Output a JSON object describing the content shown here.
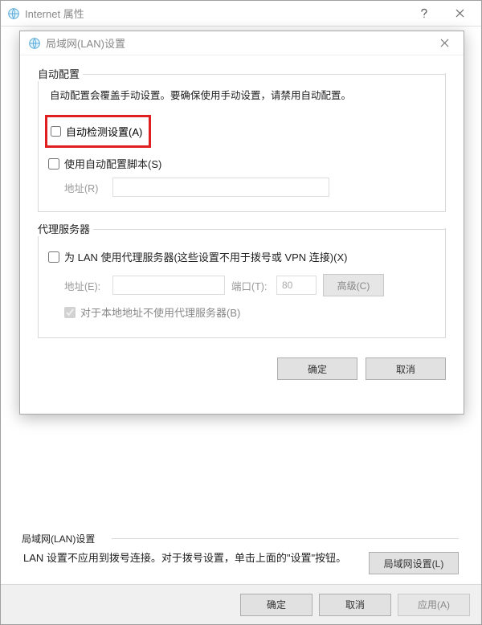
{
  "parent": {
    "title": "Internet 属性",
    "lan_section": {
      "header_truncated": "局域网(LAN)设置",
      "desc": "LAN 设置不应用到拨号连接。对于拨号设置，单击上面的\"设置\"按钮。",
      "button": "局域网设置(L)"
    },
    "footer": {
      "ok": "确定",
      "cancel": "取消",
      "apply": "应用(A)"
    }
  },
  "child": {
    "title": "局域网(LAN)设置",
    "auto": {
      "legend": "自动配置",
      "desc": "自动配置会覆盖手动设置。要确保使用手动设置，请禁用自动配置。",
      "auto_detect": "自动检测设置(A)",
      "use_script": "使用自动配置脚本(S)",
      "address_label": "地址(R)",
      "address_value": ""
    },
    "proxy": {
      "legend": "代理服务器",
      "use_proxy": "为 LAN 使用代理服务器(这些设置不用于拨号或 VPN 连接)(X)",
      "address_label": "地址(E):",
      "address_value": "",
      "port_label": "端口(T):",
      "port_value": "80",
      "advanced": "高级(C)",
      "bypass_local": "对于本地地址不使用代理服务器(B)"
    },
    "footer": {
      "ok": "确定",
      "cancel": "取消"
    }
  }
}
